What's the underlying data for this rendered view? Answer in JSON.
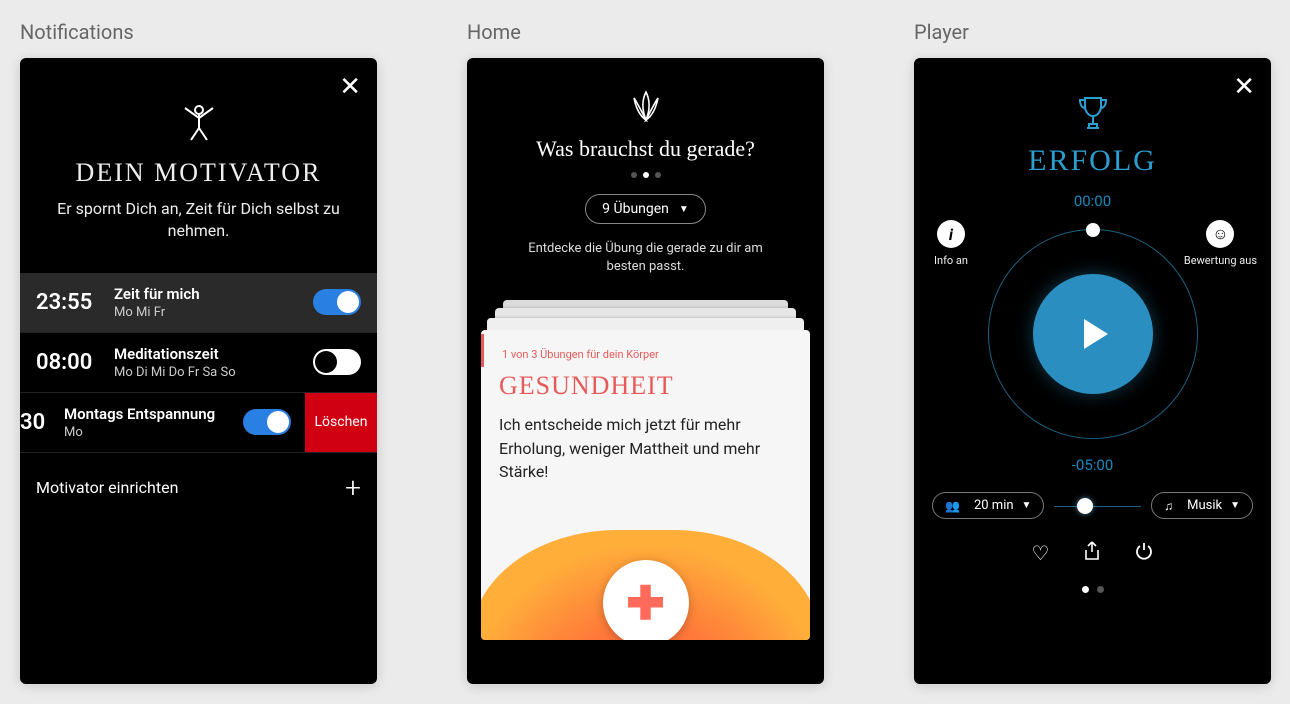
{
  "labels": {
    "notifications": "Notifications",
    "home": "Home",
    "player": "Player"
  },
  "notifications": {
    "title": "DEIN MOTIVATOR",
    "subtitle": "Er spornt Dich an, Zeit für Dich selbst zu nehmen.",
    "reminders": [
      {
        "time": "23:55",
        "name": "Zeit für mich",
        "days": "Mo Mi Fr",
        "on": true,
        "active": true
      },
      {
        "time": "08:00",
        "name": "Meditationszeit",
        "days": "Mo Di Mi Do Fr Sa So",
        "on": false,
        "active": false
      },
      {
        "time": "30",
        "name": "Montags Entspannung",
        "days": "Mo",
        "on": true,
        "active": false,
        "swiped": true
      }
    ],
    "delete_label": "Löschen",
    "add_label": "Motivator einrichten"
  },
  "home": {
    "question": "Was brauchst du gerade?",
    "filter_label": "9 Übungen",
    "hint": "Entdecke die Übung die gerade zu dir am besten passt.",
    "card": {
      "tag": "1 von 3 Übungen für dein Körper",
      "category": "GESUNDHEIT",
      "body": "Ich entscheide mich jetzt für mehr Erholung, weniger Mattheit und mehr Stärke!"
    }
  },
  "player": {
    "title": "ERFOLG",
    "elapsed": "00:00",
    "remaining": "-05:00",
    "info_label": "Info an",
    "rating_label": "Bewertung aus",
    "duration_label": "20 min",
    "music_label": "Musik",
    "slider_pos_pct": 35
  },
  "colors": {
    "accent_blue": "#2A8FC0",
    "accent_red": "#e85a5a",
    "delete_red": "#d00012"
  }
}
